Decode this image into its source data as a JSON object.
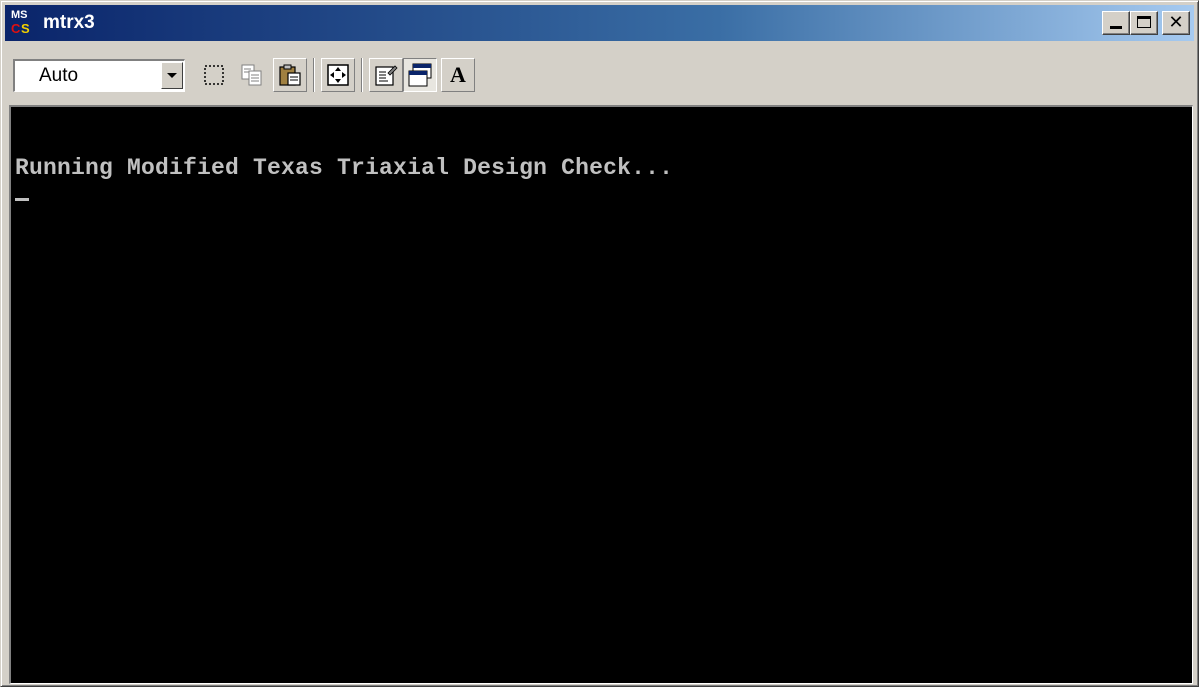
{
  "window": {
    "title": "mtrx3",
    "icon": "ms-cs-app-icon",
    "icon_text": {
      "top": "MS",
      "bottom_left": "C",
      "bottom_right": "S"
    },
    "controls": {
      "minimize": "minimize-icon",
      "maximize": "maximize-icon",
      "close": "close-icon",
      "close_glyph": "✕"
    }
  },
  "toolbar": {
    "font_size_select": {
      "value": "Auto"
    },
    "buttons": [
      {
        "name": "mark-button",
        "icon": "mark-icon"
      },
      {
        "name": "copy-button",
        "icon": "copy-icon"
      },
      {
        "name": "paste-button",
        "icon": "paste-icon"
      },
      {
        "name": "fullscreen-button",
        "icon": "fullscreen-icon"
      },
      {
        "name": "properties-button",
        "icon": "properties-icon"
      },
      {
        "name": "background-button",
        "icon": "background-icon",
        "pressed": true
      },
      {
        "name": "font-button",
        "icon": "font-icon",
        "label": "A"
      }
    ]
  },
  "console": {
    "lines": [
      "Running Modified Texas Triaxial Design Check..."
    ],
    "cursor": "_"
  },
  "colors": {
    "titlebar_start": "#0a246a",
    "titlebar_end": "#a6caf0",
    "console_bg": "#000000",
    "console_text": "#c0c0c0",
    "chrome": "#d4d0c8"
  }
}
